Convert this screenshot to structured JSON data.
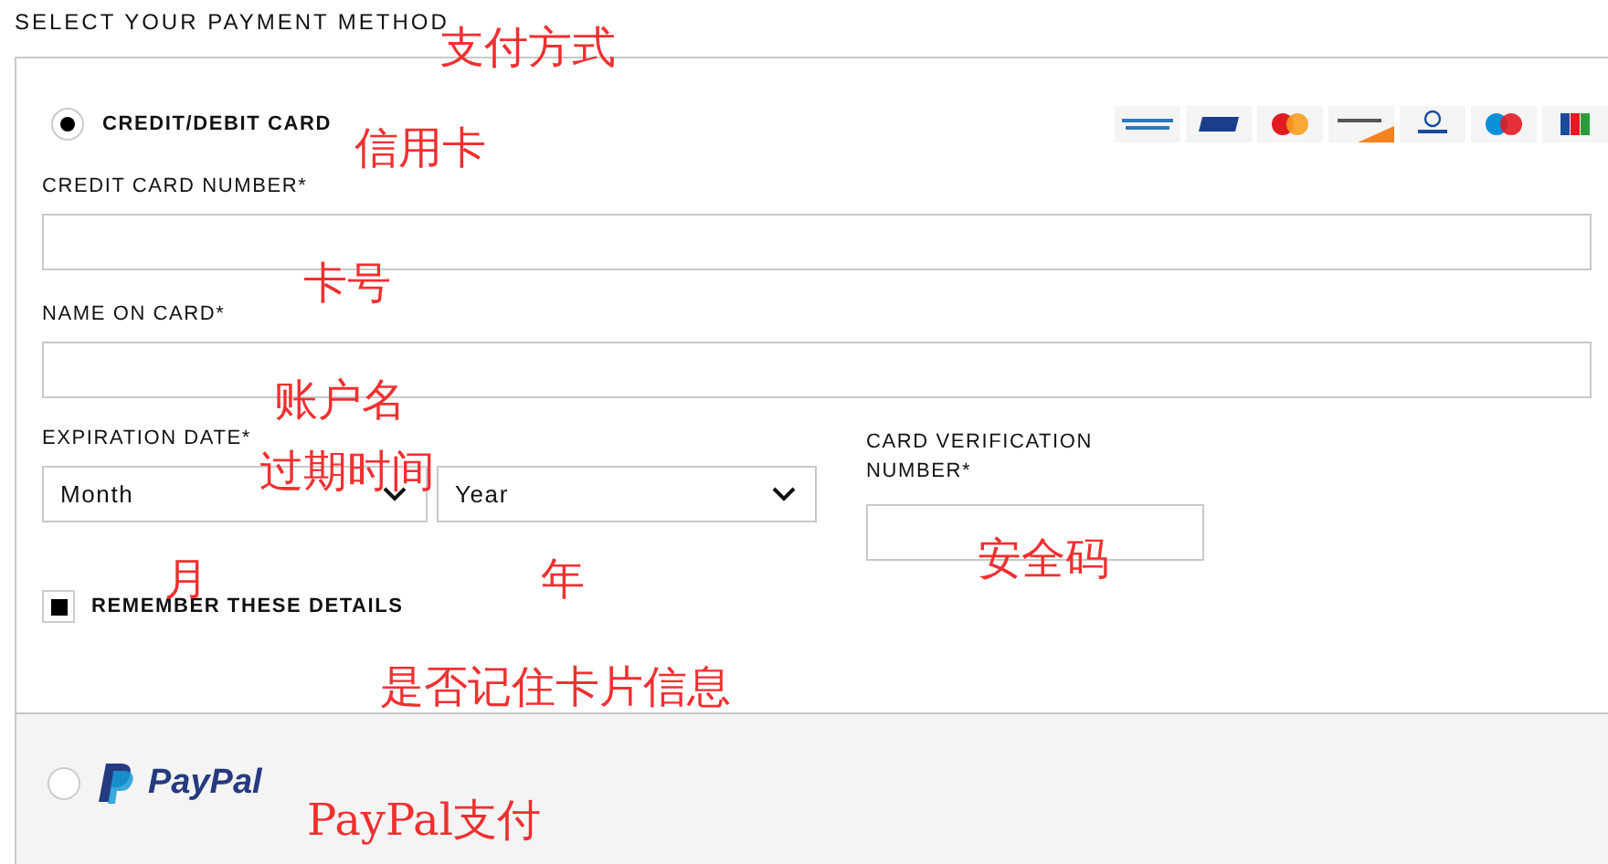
{
  "heading": "SELECT YOUR PAYMENT METHOD",
  "methods": [
    {
      "kind": "card",
      "label": "CREDIT/DEBIT CARD",
      "selected": true
    },
    {
      "kind": "paypal",
      "label": "PayPal",
      "selected": false
    }
  ],
  "card_logos": [
    {
      "kind": "amex"
    },
    {
      "kind": "visa"
    },
    {
      "kind": "mastercard"
    },
    {
      "kind": "discover"
    },
    {
      "kind": "diners"
    },
    {
      "kind": "maestro"
    },
    {
      "kind": "jcb"
    }
  ],
  "fields": [
    {
      "kind": "text",
      "label": "CREDIT CARD NUMBER*"
    },
    {
      "kind": "text",
      "label": "NAME ON CARD*"
    }
  ],
  "expiration": {
    "label": "EXPIRATION DATE*",
    "selects": [
      {
        "value": "Month"
      },
      {
        "value": "Year"
      }
    ]
  },
  "cvv": {
    "label": "CARD VERIFICATION NUMBER*"
  },
  "remember": {
    "label": "REMEMBER THESE DETAILS",
    "checked": true
  },
  "annotations": [
    "支付方式",
    "信用卡",
    "卡号",
    "账户名",
    "过期时间",
    "月",
    "年",
    "安全码",
    "是否记住卡片信息",
    "PayPal支付"
  ]
}
